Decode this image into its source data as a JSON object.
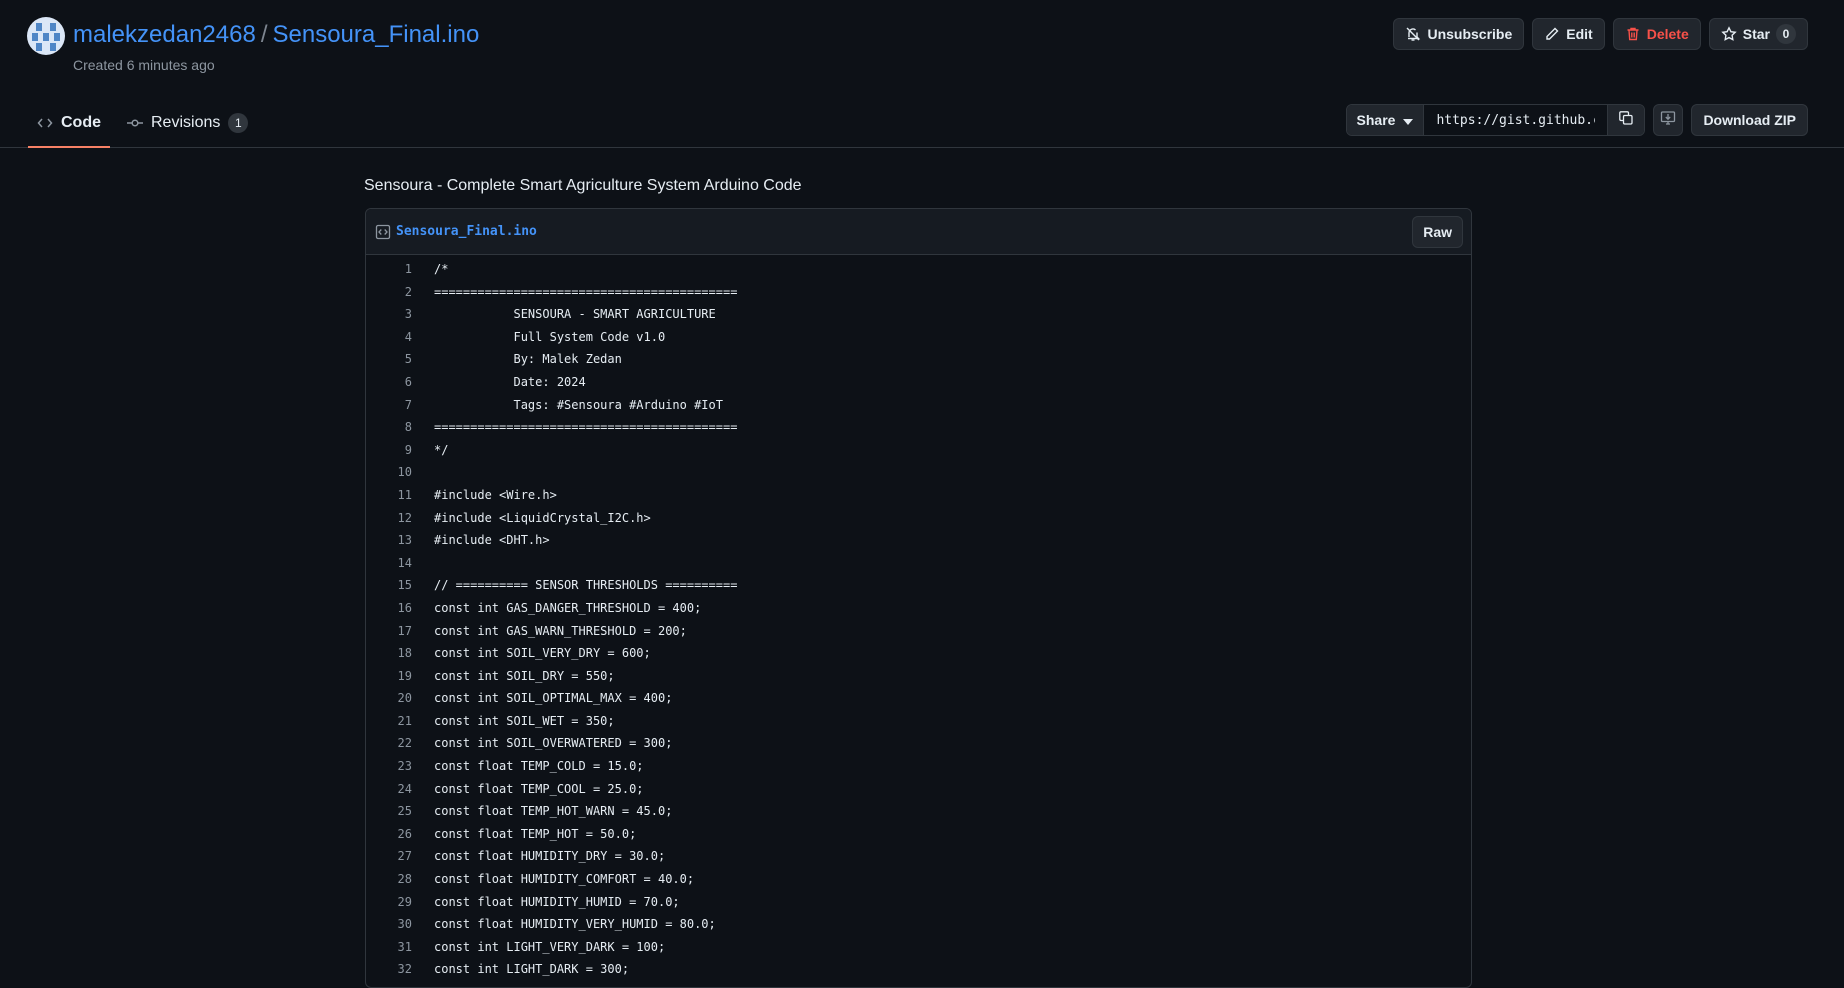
{
  "header": {
    "owner": "malekzedan2468",
    "separator": "/",
    "gist_name": "Sensoura_Final.ino",
    "created": "Created 6 minutes ago"
  },
  "actions": {
    "unsubscribe": "Unsubscribe",
    "edit": "Edit",
    "delete": "Delete",
    "star": "Star",
    "star_count": "0"
  },
  "tabs": {
    "code": "Code",
    "revisions": "Revisions",
    "revisions_count": "1"
  },
  "share": {
    "label": "Share",
    "url": "https://gist.github.c",
    "download": "Download ZIP"
  },
  "description": "Sensoura - Complete Smart Agriculture System Arduino Code",
  "file": {
    "name": "Sensoura_Final.ino",
    "raw": "Raw",
    "lines": [
      "/*",
      "==========================================",
      "           SENSOURA - SMART AGRICULTURE",
      "           Full System Code v1.0",
      "           By: Malek Zedan",
      "           Date: 2024",
      "           Tags: #Sensoura #Arduino #IoT",
      "==========================================",
      "*/",
      "",
      "#include <Wire.h>",
      "#include <LiquidCrystal_I2C.h>",
      "#include <DHT.h>",
      "",
      "// ========== SENSOR THRESHOLDS ==========",
      "const int GAS_DANGER_THRESHOLD = 400;",
      "const int GAS_WARN_THRESHOLD = 200;",
      "const int SOIL_VERY_DRY = 600;",
      "const int SOIL_DRY = 550;",
      "const int SOIL_OPTIMAL_MAX = 400;",
      "const int SOIL_WET = 350;",
      "const int SOIL_OVERWATERED = 300;",
      "const float TEMP_COLD = 15.0;",
      "const float TEMP_COOL = 25.0;",
      "const float TEMP_HOT_WARN = 45.0;",
      "const float TEMP_HOT = 50.0;",
      "const float HUMIDITY_DRY = 30.0;",
      "const float HUMIDITY_COMFORT = 40.0;",
      "const float HUMIDITY_HUMID = 70.0;",
      "const float HUMIDITY_VERY_HUMID = 80.0;",
      "const int LIGHT_VERY_DARK = 100;",
      "const int LIGHT_DARK = 300;"
    ]
  }
}
